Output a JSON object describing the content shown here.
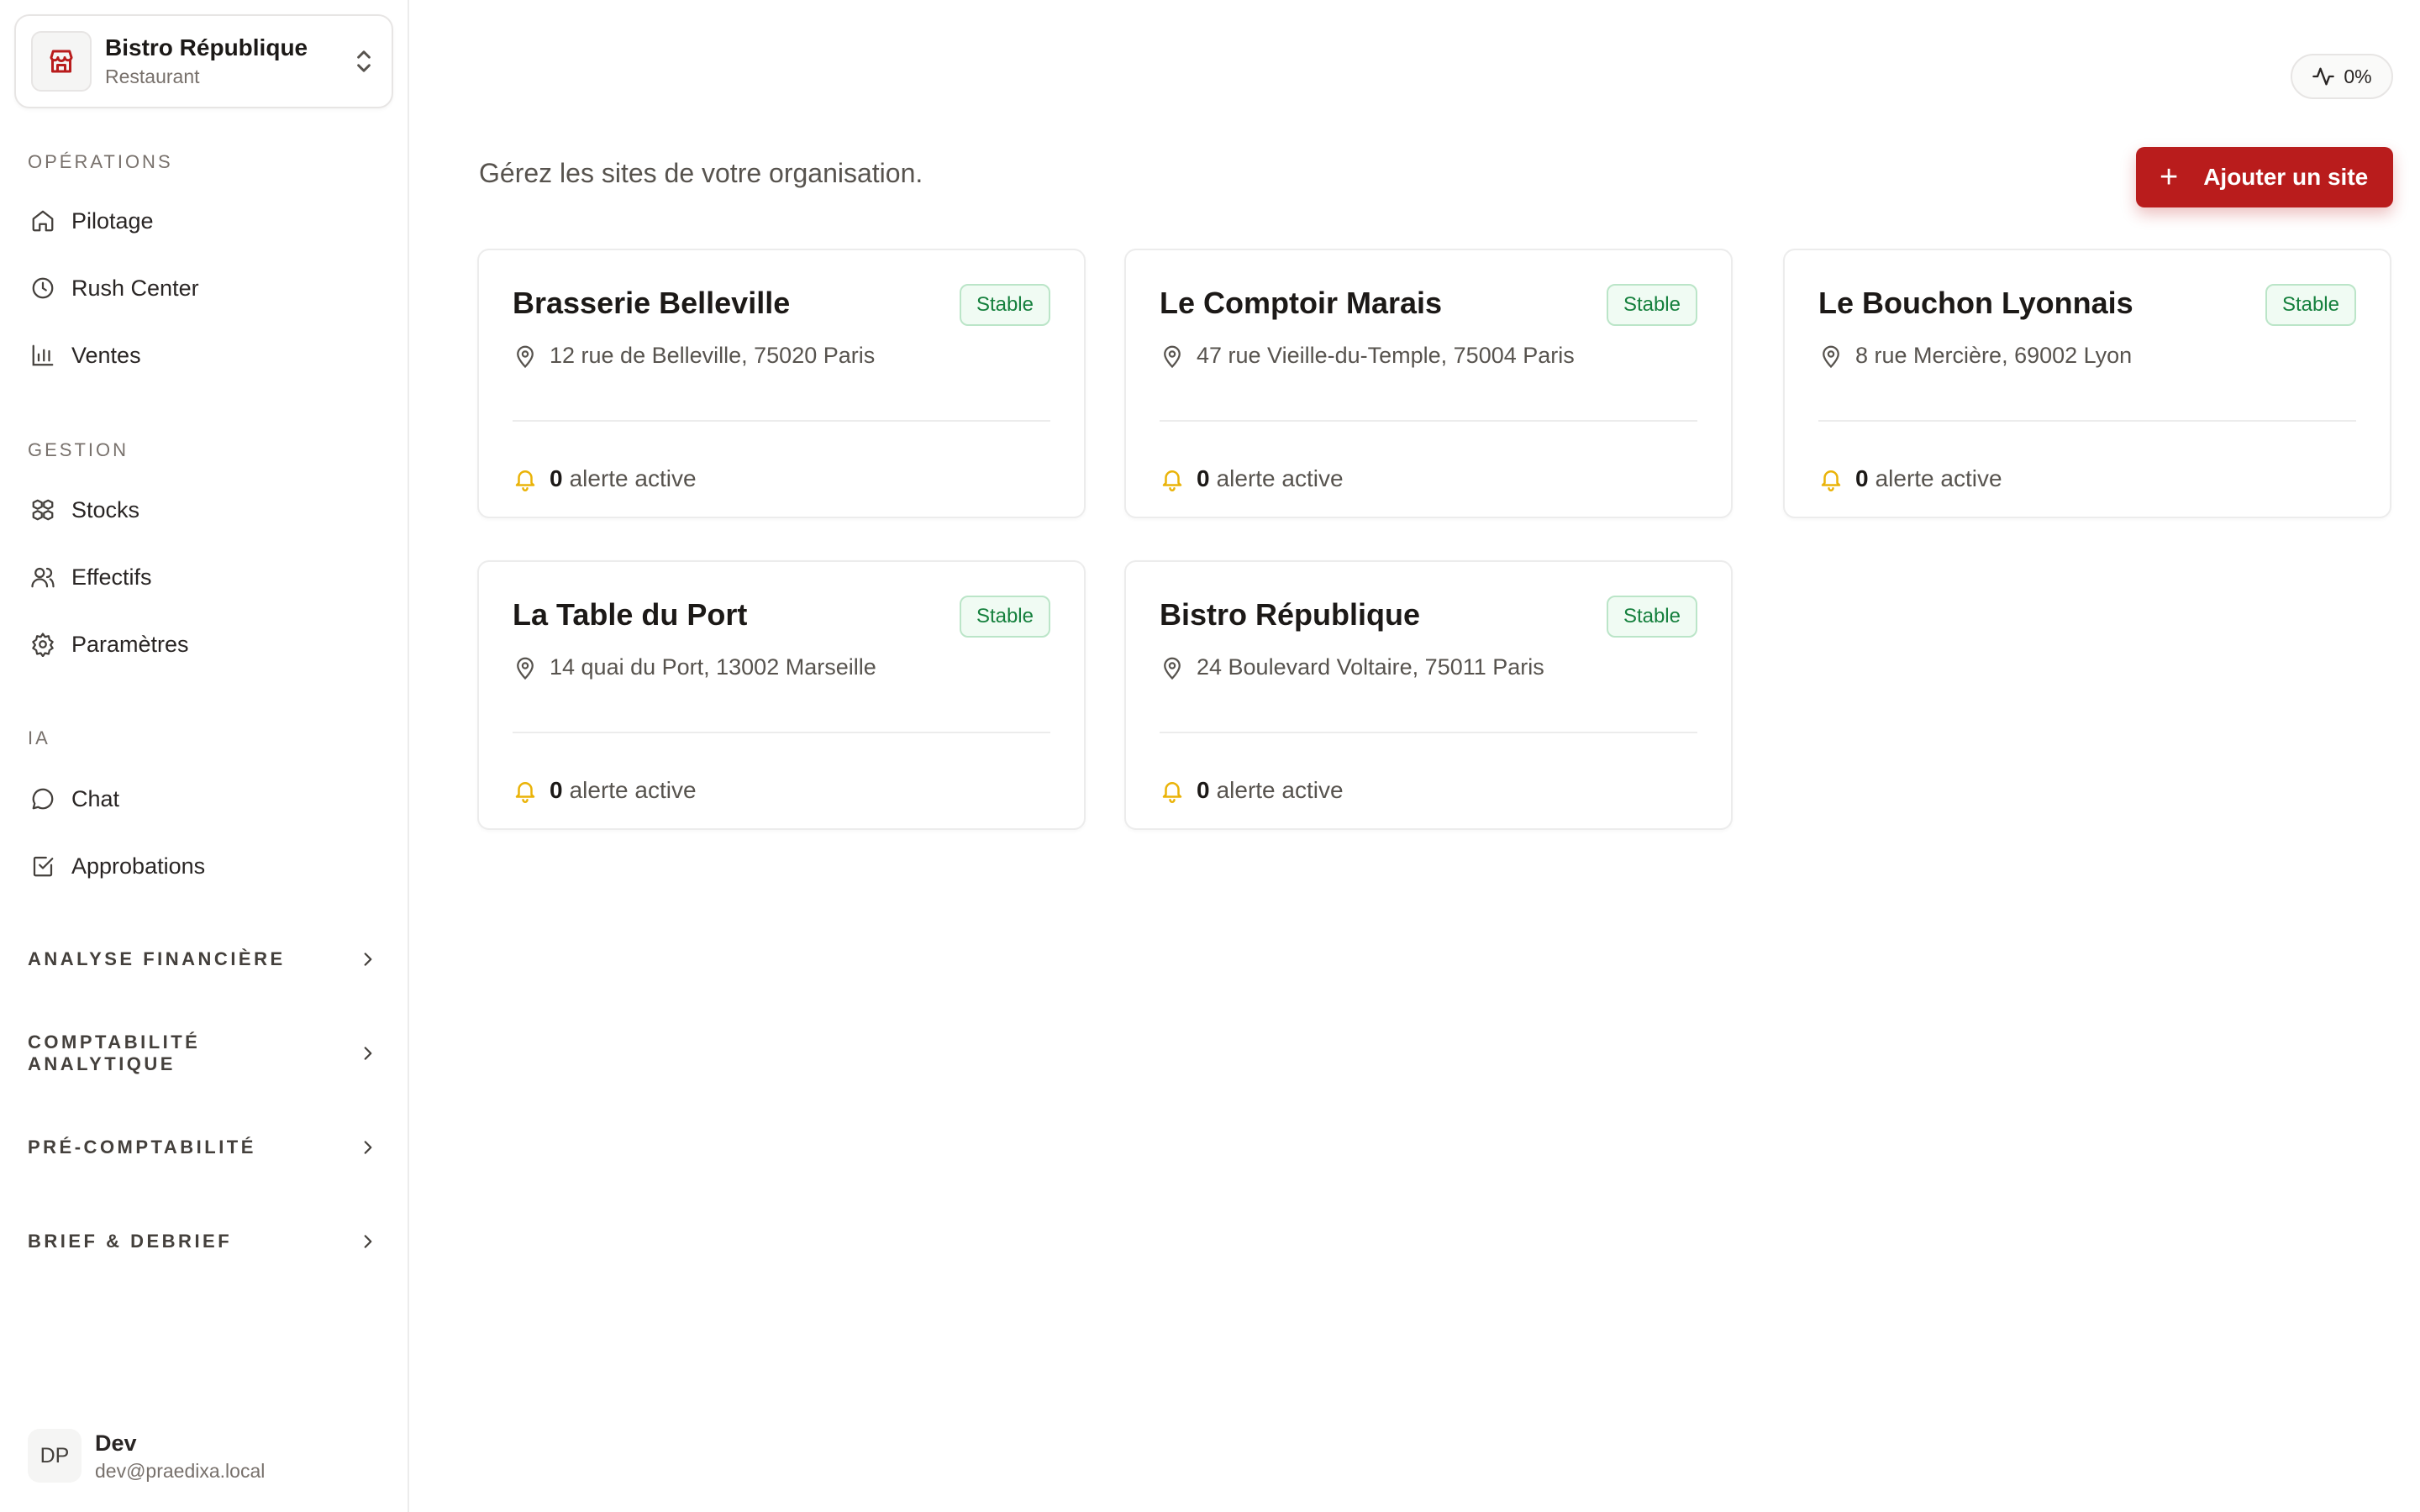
{
  "org": {
    "name": "Bistro République",
    "type": "Restaurant"
  },
  "sidebar": {
    "sections": [
      {
        "label": "OPÉRATIONS",
        "items": [
          {
            "label": "Pilotage",
            "icon": "home-icon"
          },
          {
            "label": "Rush Center",
            "icon": "clock-icon"
          },
          {
            "label": "Ventes",
            "icon": "bar-chart-icon"
          }
        ]
      },
      {
        "label": "GESTION",
        "items": [
          {
            "label": "Stocks",
            "icon": "boxes-icon"
          },
          {
            "label": "Effectifs",
            "icon": "users-icon"
          },
          {
            "label": "Paramètres",
            "icon": "gear-icon"
          }
        ]
      },
      {
        "label": "IA",
        "items": [
          {
            "label": "Chat",
            "icon": "chat-bubble-icon"
          },
          {
            "label": "Approbations",
            "icon": "checkbox-icon"
          }
        ]
      }
    ],
    "collapsibles": [
      {
        "label": "ANALYSE FINANCIÈRE"
      },
      {
        "label": "COMPTABILITÉ ANALYTIQUE"
      },
      {
        "label": "PRÉ-COMPTABILITÉ"
      },
      {
        "label": "BRIEF & DEBRIEF"
      }
    ]
  },
  "user": {
    "initials": "DP",
    "name": "Dev",
    "email": "dev@praedixa.local"
  },
  "header": {
    "activity_value": "0%",
    "subtitle": "Gérez les sites de votre organisation.",
    "add_button_label": "Ajouter un site"
  },
  "sites": [
    {
      "name": "Brasserie Belleville",
      "status": "Stable",
      "address": "12 rue de Belleville, 75020 Paris",
      "alert_count": "0",
      "alert_label": "alerte active"
    },
    {
      "name": "Le Comptoir Marais",
      "status": "Stable",
      "address": "47 rue Vieille-du-Temple, 75004 Paris",
      "alert_count": "0",
      "alert_label": "alerte active"
    },
    {
      "name": "Le Bouchon Lyonnais",
      "status": "Stable",
      "address": "8 rue Mercière, 69002 Lyon",
      "alert_count": "0",
      "alert_label": "alerte active"
    },
    {
      "name": "La Table du Port",
      "status": "Stable",
      "address": "14 quai du Port, 13002 Marseille",
      "alert_count": "0",
      "alert_label": "alerte active"
    },
    {
      "name": "Bistro République",
      "status": "Stable",
      "address": "24 Boulevard Voltaire, 75011 Paris",
      "alert_count": "0",
      "alert_label": "alerte active"
    }
  ],
  "colors": {
    "accent": "#b91c1c",
    "status_stable": "#15803d",
    "alert_bell": "#eab308"
  }
}
